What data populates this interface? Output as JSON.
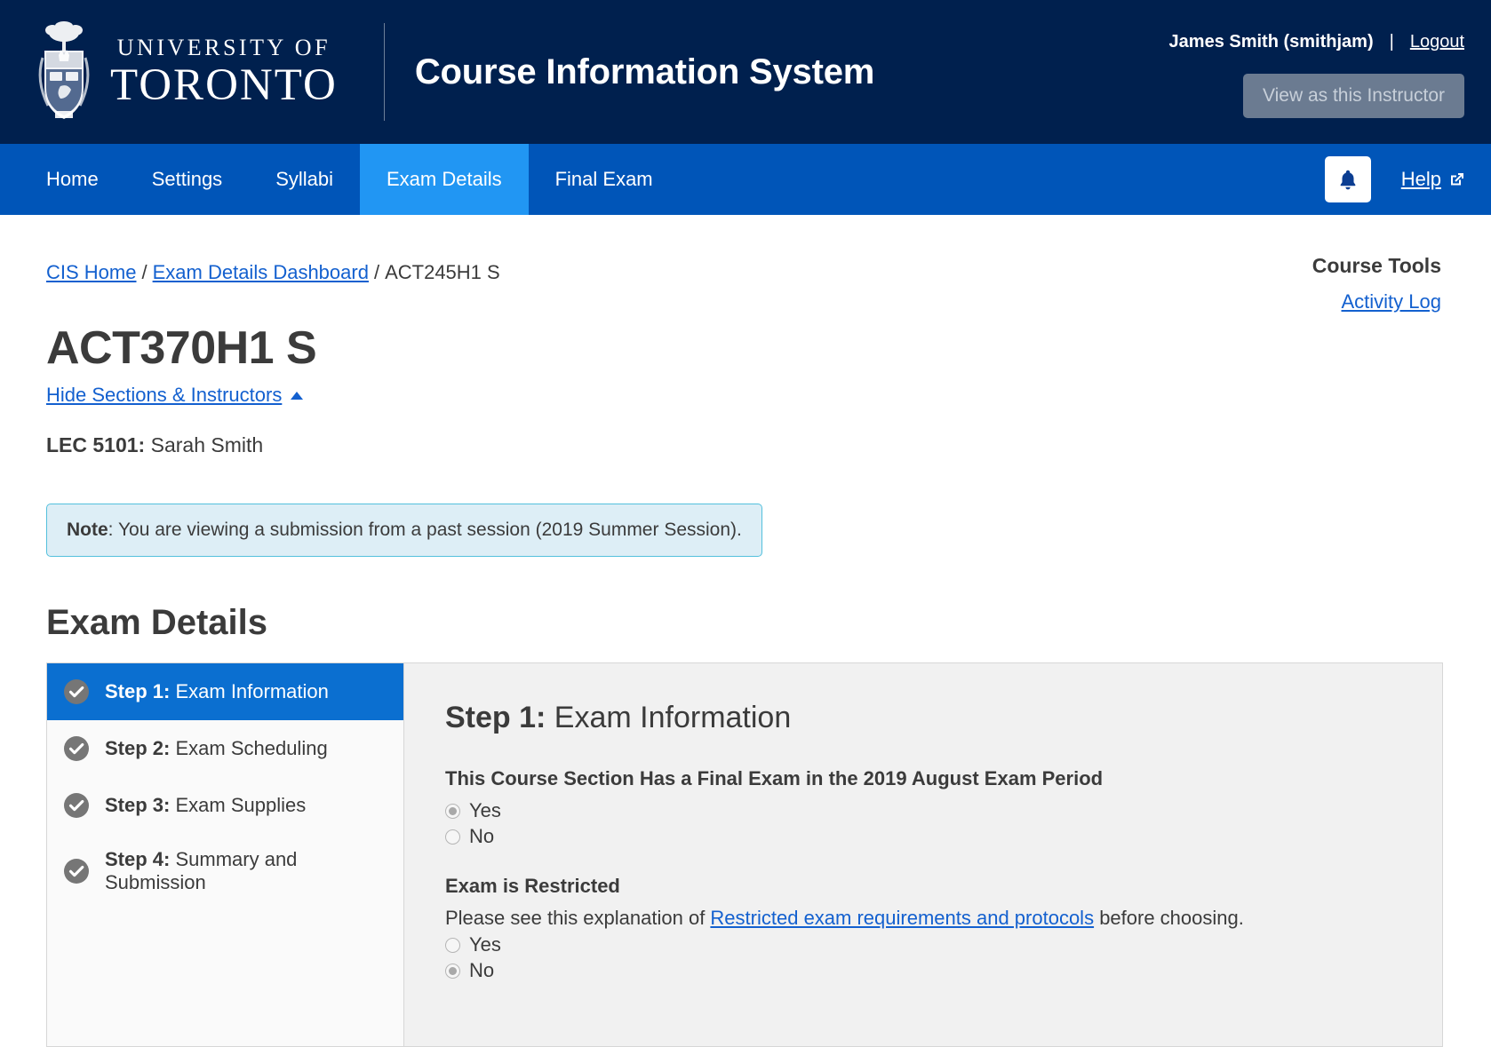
{
  "header": {
    "university_line1": "UNIVERSITY OF",
    "university_line2": "TORONTO",
    "app_title": "Course Information System",
    "user_name": "James Smith (smithjam)",
    "separator": "|",
    "logout_label": "Logout",
    "view_as_label": "View as this Instructor"
  },
  "nav": {
    "items": [
      {
        "label": "Home",
        "active": false
      },
      {
        "label": "Settings",
        "active": false
      },
      {
        "label": "Syllabi",
        "active": false
      },
      {
        "label": "Exam Details",
        "active": true
      },
      {
        "label": "Final Exam",
        "active": false
      }
    ],
    "notifications_icon": "bell-icon",
    "help_label": "Help",
    "help_icon": "external-link-icon"
  },
  "breadcrumb": {
    "home": "CIS Home",
    "dashboard": "Exam Details Dashboard",
    "current": "ACT245H1 S",
    "separator": "/"
  },
  "course_tools": {
    "title": "Course Tools",
    "activity_log": "Activity Log"
  },
  "course": {
    "title": "ACT370H1 S",
    "toggle_sections_label": "Hide Sections & Instructors",
    "section_label": "LEC 5101:",
    "section_instructor": "Sarah Smith"
  },
  "note": {
    "label": "Note",
    "text": ": You are viewing a submission from a past session (2019 Summer Session)."
  },
  "exam_details": {
    "heading": "Exam Details",
    "steps": [
      {
        "num": "Step 1:",
        "label": " Exam Information",
        "active": true
      },
      {
        "num": "Step 2:",
        "label": " Exam Scheduling",
        "active": false
      },
      {
        "num": "Step 3:",
        "label": " Exam Supplies",
        "active": false
      },
      {
        "num": "Step 4:",
        "label": " Summary and Submission",
        "active": false
      }
    ],
    "panel": {
      "step_num": "Step 1:",
      "step_title": " Exam Information",
      "fields": [
        {
          "label": "This Course Section Has a Final Exam in the 2019 August Exam Period",
          "description": null,
          "options": [
            {
              "label": "Yes",
              "checked": true
            },
            {
              "label": "No",
              "checked": false
            }
          ]
        },
        {
          "label": "Exam is Restricted",
          "description_before": "Please see this explanation of ",
          "description_link": "Restricted exam requirements and protocols",
          "description_after": " before choosing.",
          "options": [
            {
              "label": "Yes",
              "checked": false
            },
            {
              "label": "No",
              "checked": true
            }
          ]
        }
      ]
    }
  },
  "colors": {
    "header_navy": "#00204e",
    "nav_blue": "#0055b8",
    "nav_active_blue": "#2196f3",
    "link_blue": "#1360cf",
    "step_active_blue": "#0b6fd0",
    "note_bg": "#ddeef6",
    "note_border": "#53c0dd",
    "panel_bg": "#f1f1f1"
  }
}
